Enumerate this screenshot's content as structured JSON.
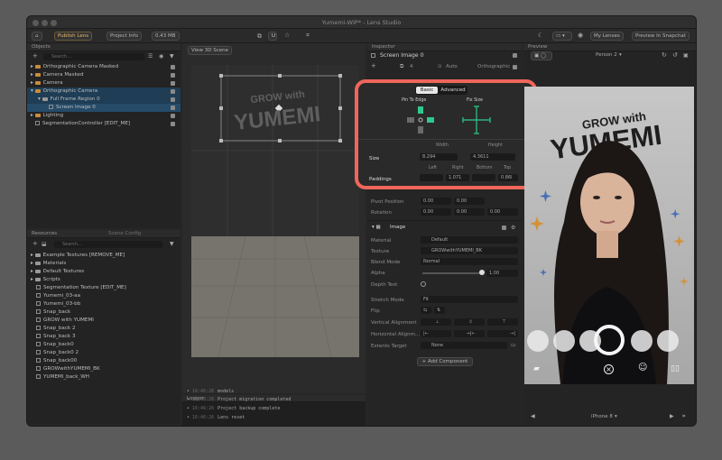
{
  "window": {
    "title": "Yumemi-WIP* - Lens Studio"
  },
  "toolbar": {
    "publish": "Publish Lens",
    "project_info": "Project Info",
    "size": "0.43 MB",
    "my_lenses": "My Lenses",
    "preview_snapchat": "Preview In Snapchat"
  },
  "objects": {
    "title": "Objects",
    "search": "Search...",
    "items": [
      "Orthographic Camera Masked",
      "Camera Masked",
      "Camera",
      "Orthographic Camera",
      "Full Frame Region 0",
      "Screen Image 0",
      "Lighting",
      "SegmentationController [EDIT_ME]"
    ]
  },
  "resources": {
    "title": "Resources",
    "scene_config": "Scene Config",
    "search": "Search...",
    "items": [
      "Example Textures [REMOVE_ME]",
      "Materials",
      "Default Textures",
      "Scripts",
      "Segmentation Texture [EDIT_ME]",
      "Yumemi_03-aa",
      "Yumemi_03-bb",
      "Snap_back",
      "GROW with YUMEMI",
      "Snap_back 2",
      "Snap_back 3",
      "Snap_back0",
      "Snap_back0 2",
      "Snap_back00",
      "GROWwithYUMEMI_BK",
      "YUMEMI_back_WH"
    ]
  },
  "scene": {
    "view_btn": "View 3D Scene",
    "sign_line1": "GROW with",
    "sign_line2": "YUMEMI"
  },
  "logger": {
    "title": "Logger",
    "lines": [
      {
        "time": "16:46:26",
        "text": "models"
      },
      {
        "time": "16:46:26",
        "text": "Project migration completed"
      },
      {
        "time": "16:46:26",
        "text": "Project backup complete"
      },
      {
        "time": "16:46:26",
        "text": "Lens reset"
      }
    ]
  },
  "inspector": {
    "title": "Inspector",
    "object_name": "Screen Image 0",
    "layer_count": "4",
    "mode": "Auto",
    "projection": "Orthographic",
    "tab_basic": "Basic",
    "tab_advanced": "Advanced",
    "pin_to_edge": "Pin To Edge",
    "fix_size": "Fix Size",
    "width_label": "Width",
    "height_label": "Height",
    "size_label": "Size",
    "width_val": "8.294",
    "height_val": "4.3611",
    "paddings_label": "Paddings",
    "left_label": "Left",
    "right_label": "Right",
    "bottom_label": "Bottom",
    "top_label": "Top",
    "pad_left": "",
    "pad_right": "1.071",
    "pad_bottom": "",
    "pad_top": "0.86l",
    "pivot_label": "Pivot Position",
    "pivot_x": "0.00",
    "pivot_y": "0.00",
    "rotation_label": "Rotation",
    "rot_x": "0.00",
    "rot_y": "0.00",
    "rot_z": "0.00",
    "image_section": "Image",
    "material_label": "Material",
    "material_val": "Default",
    "texture_label": "Texture",
    "texture_val": "GROWwithYUMEMI_BK",
    "blend_label": "Blend Mode",
    "blend_val": "Normal",
    "alpha_label": "Alpha",
    "alpha_val": "1.00",
    "alpha_fraction": 1.0,
    "depth_label": "Depth Test",
    "stretch_label": "Stretch Mode",
    "stretch_val": "Fit",
    "flip_label": "Flip",
    "valign_label": "Vertical Alignment",
    "halign_label": "Horizontal Alignm...",
    "extents_label": "Extents Target",
    "extents_val": "None",
    "add_component": "+ Add Component"
  },
  "preview": {
    "title": "Preview",
    "person": "Person 2",
    "sign_line1": "GROW with",
    "sign_line2": "YUMEMI",
    "device": "iPhone 8"
  }
}
